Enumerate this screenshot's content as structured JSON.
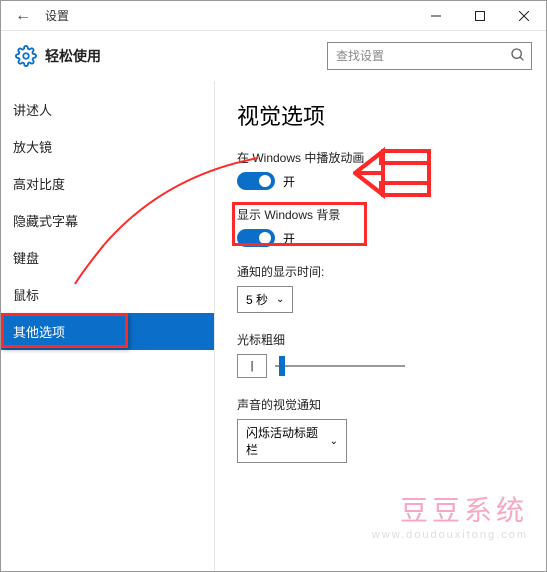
{
  "titlebar": {
    "title": "设置"
  },
  "header": {
    "title": "轻松使用",
    "search_placeholder": "查找设置"
  },
  "sidebar": {
    "items": [
      {
        "label": "讲述人"
      },
      {
        "label": "放大镜"
      },
      {
        "label": "高对比度"
      },
      {
        "label": "隐藏式字幕"
      },
      {
        "label": "键盘"
      },
      {
        "label": "鼠标"
      },
      {
        "label": "其他选项"
      }
    ]
  },
  "content": {
    "heading": "视觉选项",
    "anim_label": "在 Windows 中播放动画",
    "anim_toggle": "开",
    "bg_label": "显示 Windows 背景",
    "bg_toggle": "开",
    "notify_label": "通知的显示时间:",
    "notify_value": "5 秒",
    "cursor_label": "光标粗细",
    "cursor_value": "|",
    "audio_label": "声音的视觉通知",
    "audio_value": "闪烁活动标题栏"
  },
  "watermark": {
    "line1": "豆豆系统",
    "line2": "www.doudouxitong.com"
  }
}
